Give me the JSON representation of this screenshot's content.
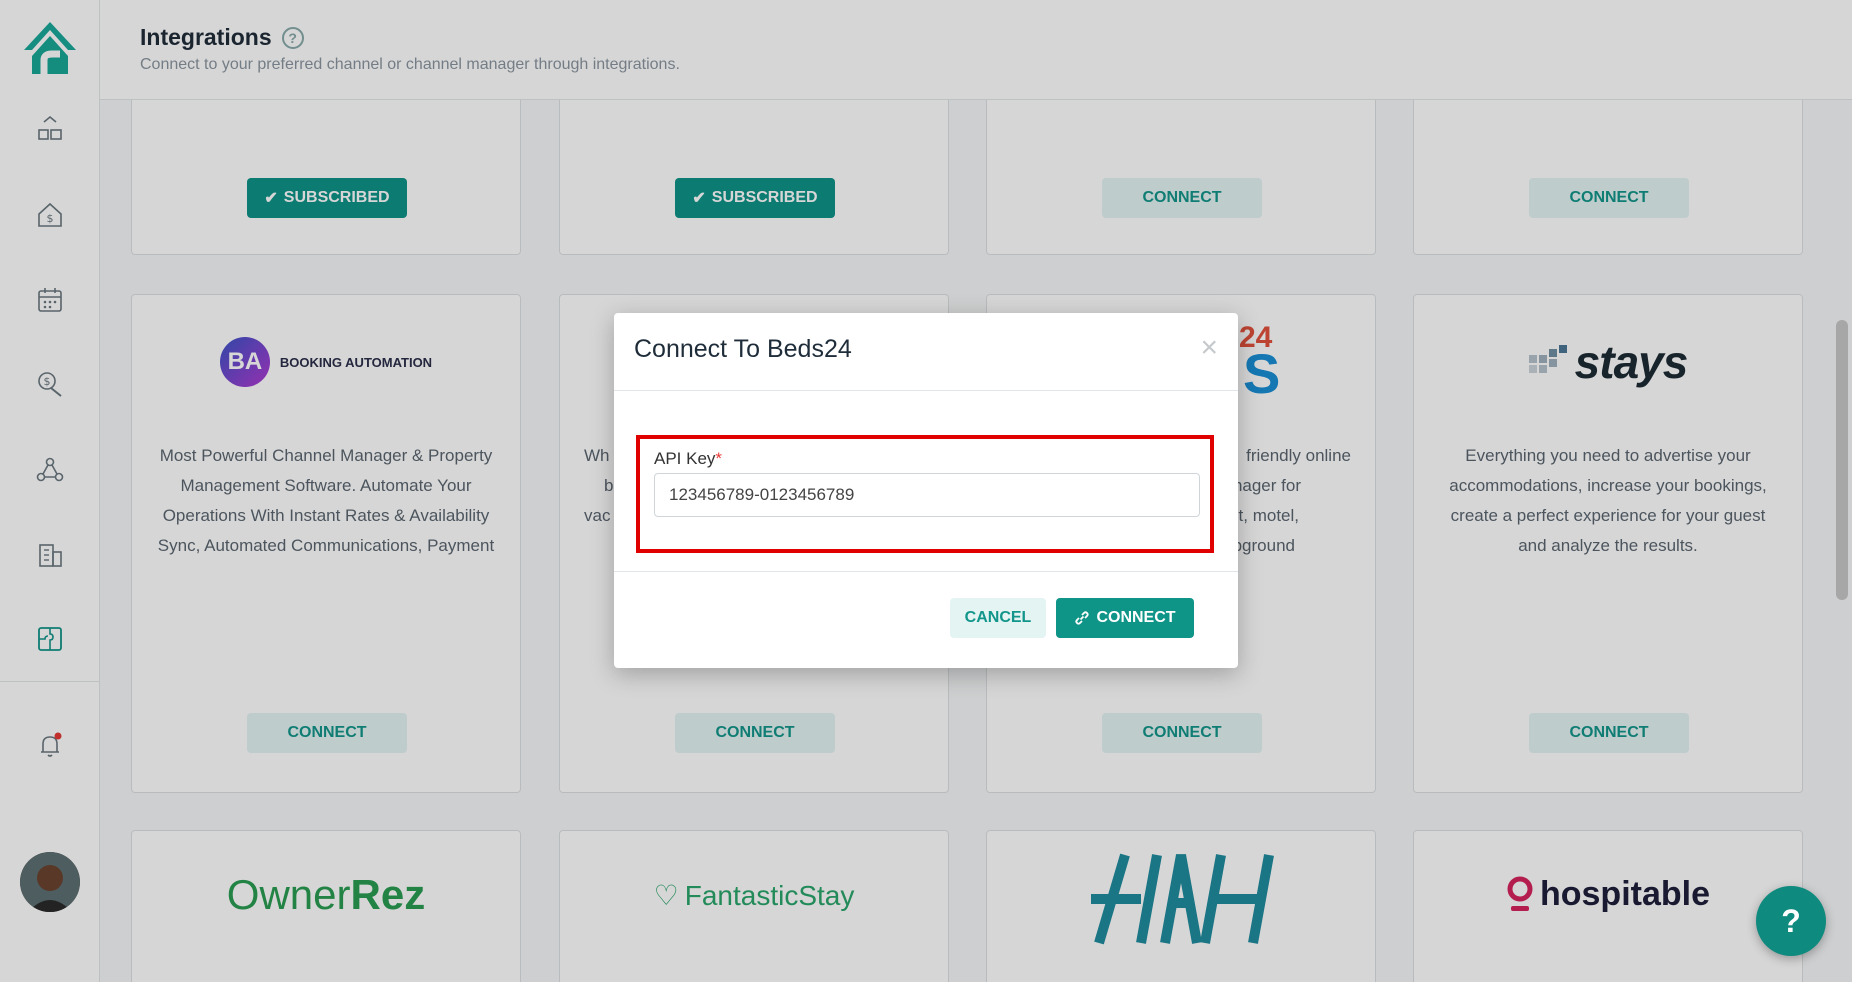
{
  "header": {
    "title": "Integrations",
    "subtitle": "Connect to your preferred channel or channel manager through integrations."
  },
  "sidebar": {
    "items": [
      {
        "icon": "dashboard-icon"
      },
      {
        "icon": "house-dollar-icon"
      },
      {
        "icon": "calendar-icon"
      },
      {
        "icon": "dollar-wrench-icon"
      },
      {
        "icon": "network-icon"
      },
      {
        "icon": "building-icon"
      },
      {
        "icon": "puzzle-icon",
        "active": true
      },
      {
        "icon": "bell-icon"
      }
    ]
  },
  "cards_row1": [
    {
      "button": "SUBSCRIBED"
    },
    {
      "button": "SUBSCRIBED"
    },
    {
      "button": "CONNECT"
    },
    {
      "button": "CONNECT"
    }
  ],
  "cards_row2": [
    {
      "logo_text": "BA",
      "logo_caption": "BOOKING AUTOMATION",
      "description": "Most Powerful Channel Manager & Property Management Software. Automate Your Operations With Instant Rates & Availability Sync, Automated Communications, Payment",
      "button": "CONNECT"
    },
    {
      "description_lines": [
        "Wh",
        "b",
        "vac",
        "e"
      ],
      "button": "CONNECT"
    },
    {
      "logo_text_top": "24",
      "logo_text_bottom": "S",
      "description_lines": [
        "friendly online",
        "l manager for",
        "fast, motel,",
        "mpground"
      ],
      "button": "CONNECT"
    },
    {
      "logo_text": "stays",
      "description": "Everything you need to advertise your accommodations, increase your bookings, create a perfect experience for your guest and analyze the results.",
      "button": "CONNECT"
    }
  ],
  "cards_row3": [
    {
      "logo_part1": "Owner",
      "logo_part2": "Rez"
    },
    {
      "logo": "FantasticStay"
    },
    {
      "logo": "HAH"
    },
    {
      "logo": "hospitable"
    }
  ],
  "modal": {
    "title": "Connect To Beds24",
    "close": "×",
    "field_label": "API Key",
    "required_mark": "*",
    "api_key_value": "123456789-0123456789",
    "cancel_label": "CANCEL",
    "connect_label": "CONNECT"
  },
  "fab": {
    "label": "?"
  },
  "colors": {
    "primary": "#0f9488",
    "primary_light": "#e4f4f3",
    "highlight": "#e00000"
  }
}
